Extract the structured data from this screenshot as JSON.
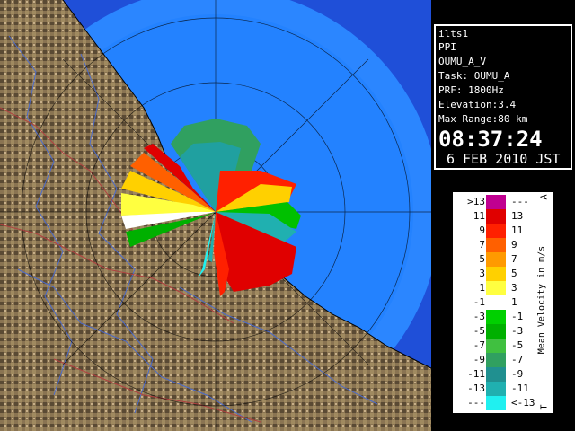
{
  "info": {
    "radar_name": "ilts1",
    "product": "PPI",
    "scan_id": "OUMU_A_V",
    "task": "Task: OUMU_A",
    "prf": "PRF: 1800Hz",
    "elevation": "Elevation:3.4",
    "max_range": "Max Range:80 km",
    "time": "08:37:24",
    "date": "6 FEB 2010 JST"
  },
  "legend": {
    "title": "Mean Velocity in m/s",
    "corner_top": "A",
    "corner_bottom": "T",
    "bins": [
      {
        "left": ">13",
        "right": "---",
        "color": "#c00090"
      },
      {
        "left": "11",
        "right": "13",
        "color": "#e00000"
      },
      {
        "left": "9",
        "right": "11",
        "color": "#ff2000"
      },
      {
        "left": "7",
        "right": "9",
        "color": "#ff6000"
      },
      {
        "left": "5",
        "right": "7",
        "color": "#ff9a00"
      },
      {
        "left": "3",
        "right": "5",
        "color": "#ffd000"
      },
      {
        "left": "1",
        "right": "3",
        "color": "#ffff40"
      },
      {
        "left": "-1",
        "right": "1",
        "color": "#ffffff"
      },
      {
        "left": "-3",
        "right": "-1",
        "color": "#00d000"
      },
      {
        "left": "-5",
        "right": "-3",
        "color": "#00b000"
      },
      {
        "left": "-7",
        "right": "-5",
        "color": "#40c040"
      },
      {
        "left": "-9",
        "right": "-7",
        "color": "#30a060"
      },
      {
        "left": "-11",
        "right": "-9",
        "color": "#209090"
      },
      {
        "left": "-13",
        "right": "-11",
        "color": "#20b0b0"
      },
      {
        "left": "---",
        "right": "<-13",
        "color": "#20f0f0"
      }
    ]
  },
  "colors": {
    "sea": "#1a6cff",
    "land": "#7a6a4a",
    "range_rings": "#000000"
  }
}
